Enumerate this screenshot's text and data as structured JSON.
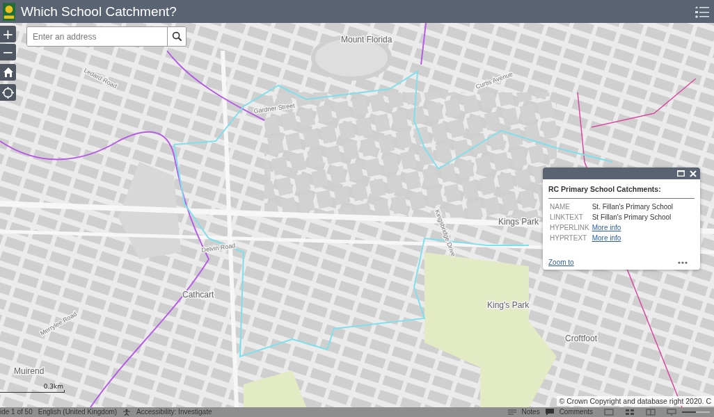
{
  "header": {
    "title": "Which School Catchment?"
  },
  "search": {
    "placeholder": "Enter an address"
  },
  "zoom_buttons": [
    "+",
    "−"
  ],
  "map_labels": [
    {
      "text": "Mount Florida",
      "kind": "place"
    },
    {
      "text": "Cathcart",
      "kind": "place"
    },
    {
      "text": "King's Park",
      "kind": "place"
    },
    {
      "text": "Croftfoot",
      "kind": "place"
    },
    {
      "text": "Muirend",
      "kind": "place"
    },
    {
      "text": "Kings Park",
      "kind": "place"
    },
    {
      "text": "Ledard Road",
      "kind": "road"
    },
    {
      "text": "Curtis Avenue",
      "kind": "road"
    },
    {
      "text": "Delvin Road",
      "kind": "road"
    },
    {
      "text": "Merrylee Road",
      "kind": "road"
    },
    {
      "text": "Kingsbridge Drive",
      "kind": "road"
    },
    {
      "text": "Gardner Street",
      "kind": "road"
    }
  ],
  "popup": {
    "title": "RC Primary School Catchments:",
    "fields": [
      {
        "label": "NAME",
        "value": "St. Fillan's Primary School",
        "kind": "text"
      },
      {
        "label": "LINKTEXT",
        "value": "St Fillan's Primary School",
        "kind": "text"
      },
      {
        "label": "HYPERLINK",
        "value": "More info",
        "kind": "link"
      },
      {
        "label": "HYPRTEXT",
        "value": "More info",
        "kind": "link"
      }
    ],
    "action": "Zoom to"
  },
  "scale_bar": {
    "label": "0.3km"
  },
  "attribution": "© Crown Copyright and database right 2020. C",
  "status_bar": {
    "slide": "ide 1 of 50",
    "language": "English (United Kingdom)",
    "accessibility": "Accessibility: Investigate",
    "notes": "Notes",
    "comments": "Comments"
  },
  "zoom_slider": {
    "level": 0.5
  }
}
